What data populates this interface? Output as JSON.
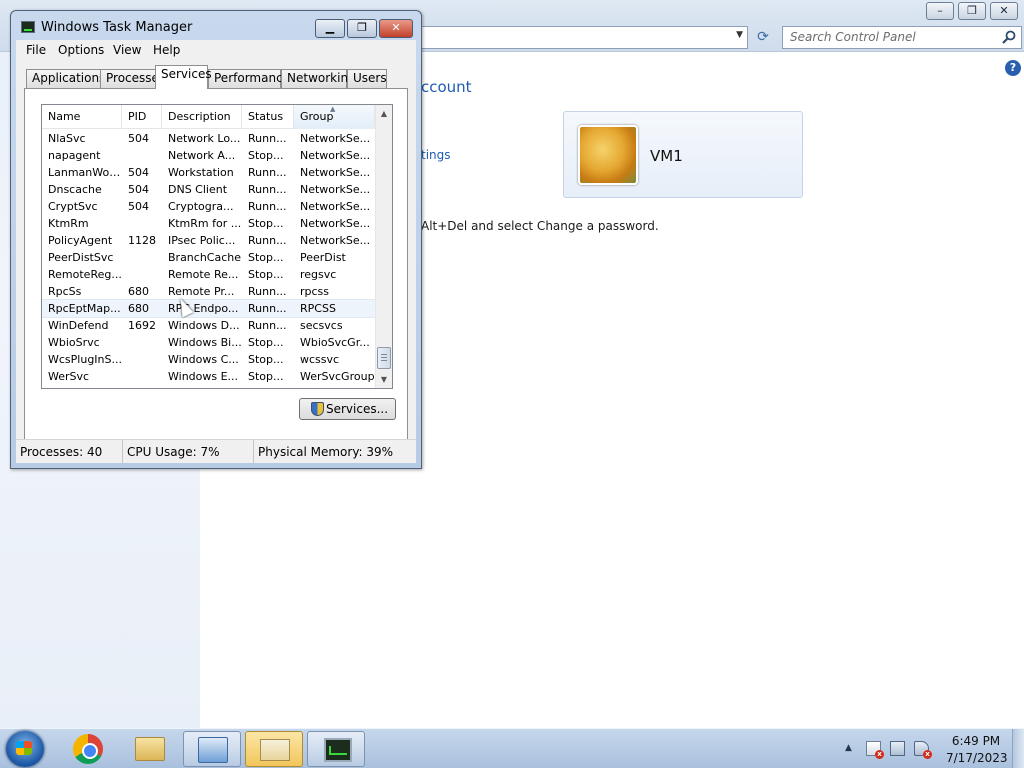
{
  "control_panel": {
    "search_placeholder": "Search Control Panel",
    "help_label": "?",
    "heading_partial": "ccount",
    "link_partial": "tings",
    "instruction_partial": "Alt+Del and select Change a password.",
    "user_name": "VM1"
  },
  "task_manager": {
    "title": "Windows Task Manager",
    "menu": [
      "File",
      "Options",
      "View",
      "Help"
    ],
    "tabs": [
      "Applications",
      "Processes",
      "Services",
      "Performance",
      "Networking",
      "Users"
    ],
    "active_tab": "Services",
    "columns": [
      "Name",
      "PID",
      "Description",
      "Status",
      "Group"
    ],
    "sorted_column": "Group",
    "rows": [
      {
        "name": "NlaSvc",
        "pid": "504",
        "description": "Network Lo...",
        "status": "Runn...",
        "group": "NetworkSe..."
      },
      {
        "name": "napagent",
        "pid": "",
        "description": "Network A...",
        "status": "Stop...",
        "group": "NetworkSe..."
      },
      {
        "name": "LanmanWor...",
        "pid": "504",
        "description": "Workstation",
        "status": "Runn...",
        "group": "NetworkSe..."
      },
      {
        "name": "Dnscache",
        "pid": "504",
        "description": "DNS Client",
        "status": "Runn...",
        "group": "NetworkSe..."
      },
      {
        "name": "CryptSvc",
        "pid": "504",
        "description": "Cryptogra...",
        "status": "Runn...",
        "group": "NetworkSe..."
      },
      {
        "name": "KtmRm",
        "pid": "",
        "description": "KtmRm for ...",
        "status": "Stop...",
        "group": "NetworkSe..."
      },
      {
        "name": "PolicyAgent",
        "pid": "1128",
        "description": "IPsec Polic...",
        "status": "Runn...",
        "group": "NetworkSe..."
      },
      {
        "name": "PeerDistSvc",
        "pid": "",
        "description": "BranchCache",
        "status": "Stop...",
        "group": "PeerDist"
      },
      {
        "name": "RemoteReg...",
        "pid": "",
        "description": "Remote Re...",
        "status": "Stop...",
        "group": "regsvc"
      },
      {
        "name": "RpcSs",
        "pid": "680",
        "description": "Remote Pr...",
        "status": "Runn...",
        "group": "rpcss"
      },
      {
        "name": "RpcEptMap...",
        "pid": "680",
        "description": "RPC Endpo...",
        "status": "Runn...",
        "group": "RPCSS"
      },
      {
        "name": "WinDefend",
        "pid": "1692",
        "description": "Windows D...",
        "status": "Runn...",
        "group": "secsvcs"
      },
      {
        "name": "WbioSrvc",
        "pid": "",
        "description": "Windows Bi...",
        "status": "Stop...",
        "group": "WbioSvcGr..."
      },
      {
        "name": "WcsPlugInS...",
        "pid": "",
        "description": "Windows C...",
        "status": "Stop...",
        "group": "wcssvc"
      },
      {
        "name": "WerSvc",
        "pid": "",
        "description": "Windows E...",
        "status": "Stop...",
        "group": "WerSvcGroup"
      }
    ],
    "hover_row_index": 10,
    "services_button": "Services...",
    "status": {
      "processes": "Processes: 40",
      "cpu": "CPU Usage: 7%",
      "memory": "Physical Memory: 39%"
    }
  },
  "taskbar": {
    "items": [
      "start-button",
      "chrome-icon",
      "explorer-icon",
      "control-panel-icon",
      "mail-icon",
      "task-manager-icon"
    ],
    "active_item": "mail-icon",
    "clock_time": "6:49 PM",
    "clock_date": "7/17/2023"
  },
  "colors": {
    "link_blue": "#1e5bb2",
    "taskbar_active": "#f2c65a",
    "close_red": "#c2412b"
  }
}
